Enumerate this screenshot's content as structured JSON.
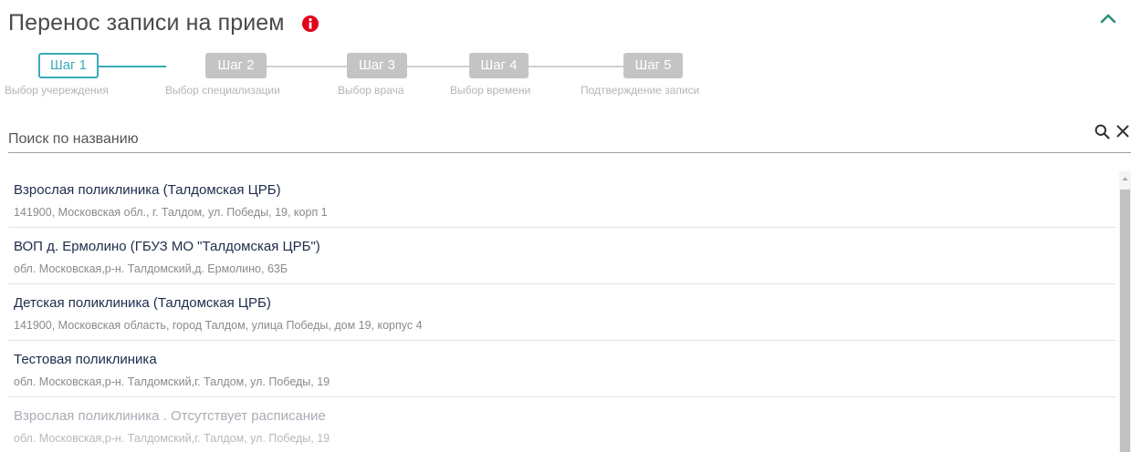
{
  "header": {
    "title": "Перенос записи на прием"
  },
  "icons": {
    "info": "info-icon",
    "collapse": "chevron-up-icon",
    "search": "search-icon",
    "clear": "close-icon"
  },
  "colors": {
    "accent": "#3aa9b9",
    "info_red": "#e4001b",
    "chevron": "#2a8f75",
    "inactive_step": "#c4c4c4"
  },
  "stepper": {
    "current_step": 1,
    "steps": [
      {
        "box": "Шаг 1",
        "label": "Выбор учереждения"
      },
      {
        "box": "Шаг 2",
        "label": "Выбор специализации"
      },
      {
        "box": "Шаг 3",
        "label": "Выбор врача"
      },
      {
        "box": "Шаг 4",
        "label": "Выбор времени"
      },
      {
        "box": "Шаг 5",
        "label": "Подтверждение записи"
      }
    ]
  },
  "search": {
    "placeholder": "Поиск по названию",
    "value": ""
  },
  "clinics": [
    {
      "name": "Взрослая поликлиника (Талдомская ЦРБ)",
      "address": "141900, Московская обл., г. Талдом, ул. Победы, 19, корп 1",
      "disabled": false
    },
    {
      "name": "ВОП д. Ермолино (ГБУЗ МО \"Талдомская ЦРБ\")",
      "address": "обл. Московская,р-н. Талдомский,д. Ермолино, 63Б",
      "disabled": false
    },
    {
      "name": "Детская поликлиника (Талдомская ЦРБ)",
      "address": "141900, Московская область, город Талдом, улица Победы, дом 19, корпус 4",
      "disabled": false
    },
    {
      "name": "Тестовая поликлиника",
      "address": "обл. Московская,р-н. Талдомский,г. Талдом, ул. Победы, 19",
      "disabled": false
    },
    {
      "name": "Взрослая поликлиника . Отсутствует расписание",
      "address": "обл. Московская,р-н. Талдомский,г. Талдом, ул. Победы, 19",
      "disabled": true
    }
  ]
}
